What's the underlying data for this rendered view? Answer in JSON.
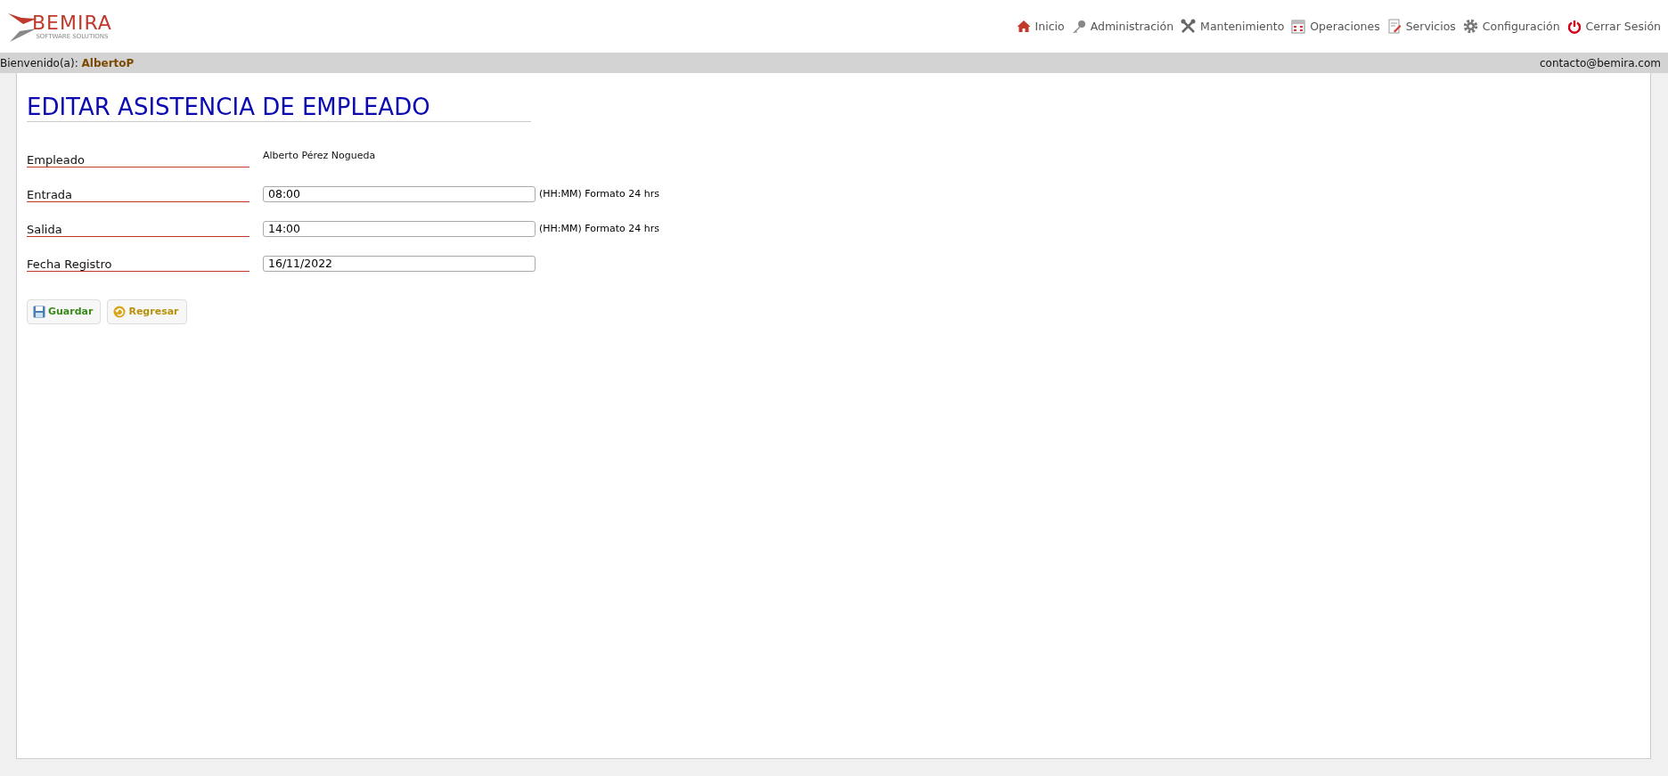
{
  "logo": {
    "name": "BEMIRA",
    "tagline": "SOFTWARE SOLUTIONS"
  },
  "nav": [
    {
      "label": "Inicio"
    },
    {
      "label": "Administración"
    },
    {
      "label": "Mantenimiento"
    },
    {
      "label": "Operaciones"
    },
    {
      "label": "Servicios"
    },
    {
      "label": "Configuración"
    },
    {
      "label": "Cerrar Sesión"
    }
  ],
  "user_bar": {
    "greeting": "Bienvenido(a):",
    "user": "AlbertoP",
    "email": "contacto@bemira.com"
  },
  "form": {
    "title": "EDITAR ASISTENCIA DE EMPLEADO",
    "fields": [
      {
        "kind": "text",
        "label": "Empleado",
        "value": "Alberto Pérez Nogueda"
      },
      {
        "kind": "input",
        "label": "Entrada",
        "value": "08:00",
        "hint": "(HH:MM) Formato 24 hrs"
      },
      {
        "kind": "input",
        "label": "Salida",
        "value": "14:00",
        "hint": "(HH:MM) Formato 24 hrs"
      },
      {
        "kind": "input",
        "label": "Fecha Registro",
        "value": "16/11/2022"
      }
    ],
    "buttons": [
      {
        "kind": "save",
        "label": "Guardar"
      },
      {
        "kind": "back",
        "label": "Regresar"
      }
    ]
  }
}
